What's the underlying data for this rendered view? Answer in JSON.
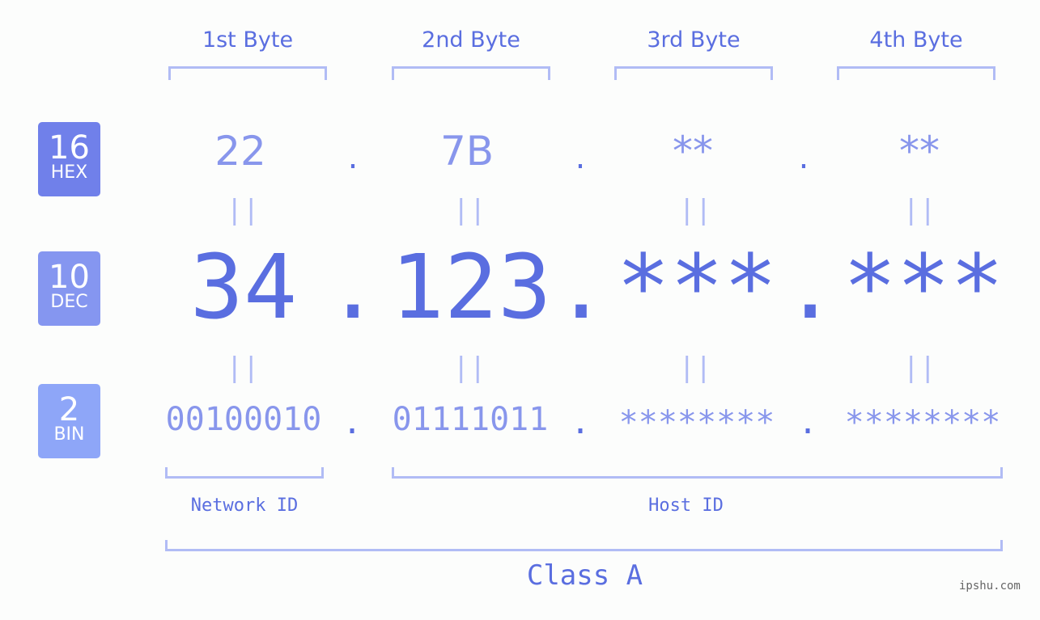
{
  "byte_headers": [
    "1st Byte",
    "2nd Byte",
    "3rd Byte",
    "4th Byte"
  ],
  "badges": {
    "hex": {
      "base": "16",
      "label": "HEX",
      "color": "#7080ea"
    },
    "dec": {
      "base": "10",
      "label": "DEC",
      "color": "#8596f0"
    },
    "bin": {
      "base": "2",
      "label": "BIN",
      "color": "#8ea6f8"
    }
  },
  "hex_values": [
    "22",
    "7B",
    "**",
    "**"
  ],
  "dec_values": [
    "34",
    "123",
    "***",
    "***"
  ],
  "bin_values": [
    "00100010",
    "01111011",
    "********",
    "********"
  ],
  "separator": ".",
  "equals": "||",
  "network_id_label": "Network ID",
  "host_id_label": "Host ID",
  "class_label": "Class A",
  "watermark": "ipshu.com",
  "colors": {
    "primary": "#5a6ee0",
    "light": "#8896ec",
    "bracket": "#b1bcf5"
  }
}
